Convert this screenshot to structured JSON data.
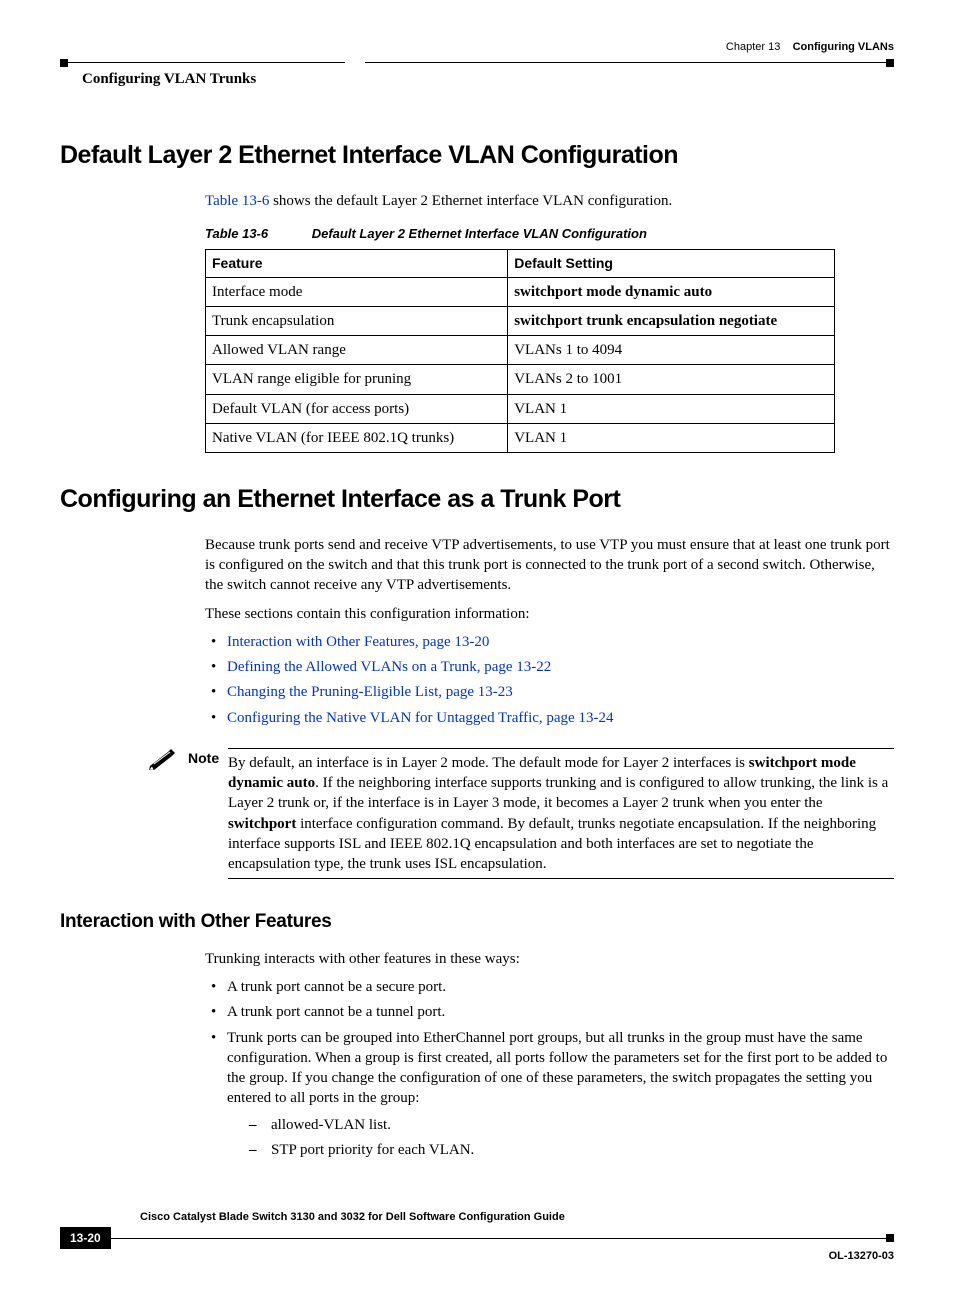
{
  "header": {
    "chapter_label": "Chapter 13",
    "chapter_title": "Configuring VLANs",
    "section_path": "Configuring VLAN Trunks"
  },
  "h1a": "Default Layer 2 Ethernet Interface VLAN Configuration",
  "intro_link": "Table 13-6",
  "intro_rest": " shows the default Layer 2 Ethernet interface VLAN configuration.",
  "table_caption_num": "Table 13-6",
  "table_caption_title": "Default Layer 2 Ethernet Interface VLAN Configuration",
  "table": {
    "headers": [
      "Feature",
      "Default Setting"
    ],
    "rows": [
      [
        "Interface mode",
        "switchport mode dynamic auto"
      ],
      [
        "Trunk encapsulation",
        "switchport trunk encapsulation negotiate"
      ],
      [
        "Allowed VLAN range",
        "VLANs 1 to 4094"
      ],
      [
        "VLAN range eligible for pruning",
        "VLANs 2 to 1001"
      ],
      [
        "Default VLAN (for access ports)",
        "VLAN 1"
      ],
      [
        "Native VLAN (for IEEE 802.1Q trunks)",
        "VLAN 1"
      ]
    ],
    "bold_rows": [
      0,
      1
    ]
  },
  "h1b": "Configuring an Ethernet Interface as a Trunk Port",
  "p1": "Because trunk ports send and receive VTP advertisements, to use VTP you must ensure that at least one trunk port is configured on the switch and that this trunk port is connected to the trunk port of a second switch. Otherwise, the switch cannot receive any VTP advertisements.",
  "p2": "These sections contain this configuration information:",
  "links": [
    "Interaction with Other Features, page 13-20",
    "Defining the Allowed VLANs on a Trunk, page 13-22",
    "Changing the Pruning-Eligible List, page 13-23",
    "Configuring the Native VLAN for Untagged Traffic, page 13-24"
  ],
  "note_label": "Note",
  "note_pre": "By default, an interface is in Layer 2 mode. The default mode for Layer 2 interfaces is ",
  "note_b1": "switchport mode dynamic auto",
  "note_mid": ". If the neighboring interface supports trunking and is configured to allow trunking, the link is a Layer 2 trunk or, if the interface is in Layer 3 mode, it becomes a Layer 2 trunk when you enter the ",
  "note_b2": "switchport",
  "note_post": " interface configuration command. By default, trunks negotiate encapsulation. If the neighboring interface supports ISL and IEEE 802.1Q encapsulation and both interfaces are set to negotiate the encapsulation type, the trunk uses ISL encapsulation.",
  "h2": "Interaction with Other Features",
  "p3": "Trunking interacts with other features in these ways:",
  "bullets2": [
    "A trunk port cannot be a secure port.",
    "A trunk port cannot be a tunnel port.",
    "Trunk ports can be grouped into EtherChannel port groups, but all trunks in the group must have the same configuration. When a group is first created, all ports follow the parameters set for the first port to be added to the group. If you change the configuration of one of these parameters, the switch propagates the setting you entered to all ports in the group:"
  ],
  "dashes": [
    "allowed-VLAN list.",
    "STP port priority for each VLAN."
  ],
  "footer": {
    "doc_title": "Cisco Catalyst Blade Switch 3130 and 3032 for Dell Software Configuration Guide",
    "page": "13-20",
    "ol": "OL-13270-03"
  }
}
